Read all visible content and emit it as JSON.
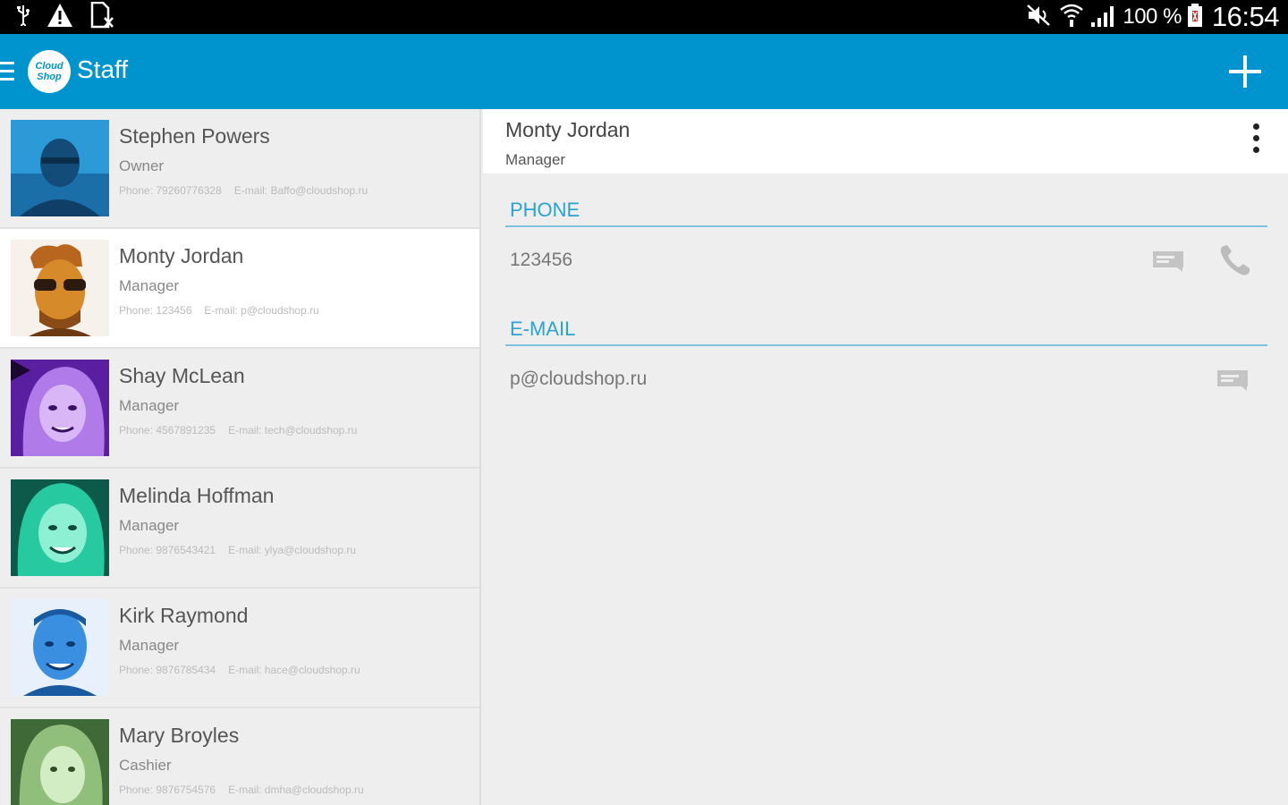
{
  "status_bar": {
    "left_icons": [
      "usb-icon",
      "warning-icon",
      "sim-card-icon"
    ],
    "right_icons": [
      "mute-icon",
      "wifi-icon",
      "signal-icon",
      "battery-icon"
    ],
    "battery": "100 %",
    "time": "16:54"
  },
  "action_bar": {
    "logo_text": "Cloud Shop",
    "title": "Staff",
    "color": "#0094cf"
  },
  "staff": [
    {
      "name": "Stephen Powers",
      "role": "Owner",
      "phone": "Phone: 79260776328",
      "email": "E-mail: Baffo@cloudshop.ru",
      "tint": "#2b9ad6"
    },
    {
      "name": "Monty Jordan",
      "role": "Manager",
      "phone": "Phone: 123456",
      "email": "E-mail: p@cloudshop.ru",
      "tint": "#d78a2a"
    },
    {
      "name": "Shay McLean",
      "role": "Manager",
      "phone": "Phone: 4567891235",
      "email": "E-mail: tech@cloudshop.ru",
      "tint": "#9b3fd8"
    },
    {
      "name": "Melinda Hoffman",
      "role": "Manager",
      "phone": "Phone: 9876543421",
      "email": "E-mail: ylya@cloudshop.ru",
      "tint": "#26c9a0"
    },
    {
      "name": "Kirk Raymond",
      "role": "Manager",
      "phone": "Phone: 9876785434",
      "email": "E-mail: hace@cloudshop.ru",
      "tint": "#3b8fe0"
    },
    {
      "name": "Mary Broyles",
      "role": "Cashier",
      "phone": "Phone: 9876754576",
      "email": "E-mail: dmha@cloudshop.ru",
      "tint": "#8fbf7a"
    }
  ],
  "detail": {
    "name": "Monty Jordan",
    "role": "Manager",
    "phone_section": "PHONE",
    "phone_value": "123456",
    "email_section": "E-MAIL",
    "email_value": "p@cloudshop.ru",
    "accent": "#2aa3d2"
  }
}
